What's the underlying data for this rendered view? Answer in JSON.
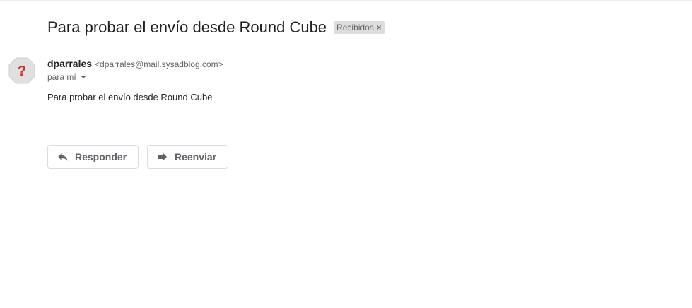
{
  "email": {
    "subject": "Para probar el envío desde Round Cube",
    "label": {
      "text": "Recibidos",
      "remove_glyph": "×"
    },
    "sender": {
      "name": "dparrales",
      "email": "<dparrales@mail.sysadblog.com>",
      "avatar_glyph": "?",
      "avatar_color": "#d93025"
    },
    "recipient_text": "para mí",
    "body": "Para probar el envío desde Round Cube"
  },
  "actions": {
    "reply_label": "Responder",
    "forward_label": "Reenviar"
  },
  "icons": {
    "avatar": "unknown-sender-icon",
    "reply": "reply-icon",
    "forward": "forward-icon",
    "details": "chevron-down-icon"
  }
}
